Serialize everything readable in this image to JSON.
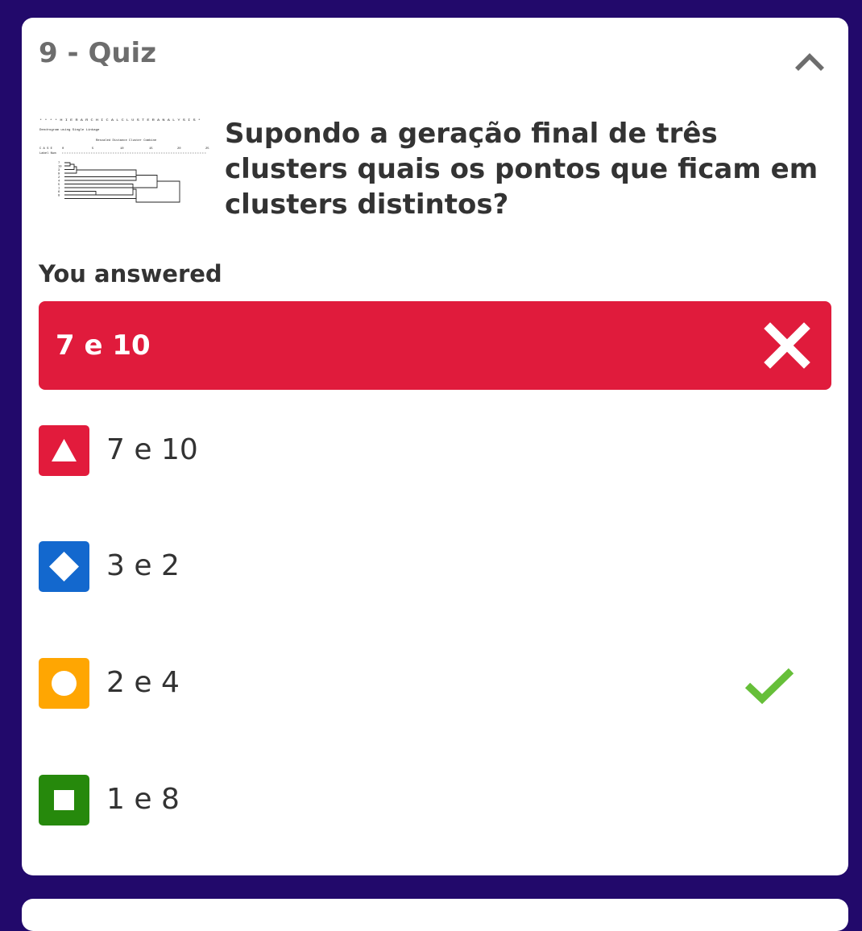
{
  "quiz": {
    "title": "9 - Quiz",
    "question": "Supondo a geração final de três clusters quais os pontos que ficam em clusters distintos?"
  },
  "image": {
    "header": "* * * * H I E R A R C H I C A L   C L U S T E R   A N A L Y S I S *",
    "subheader": "Dendrogram using Single Linkage",
    "caption": "Rescaled Distance Cluster Combine",
    "case_label": "C A S E",
    "label_num": "Label  Num",
    "ticks": [
      "0",
      "5",
      "10",
      "15",
      "20",
      "25"
    ],
    "leaves": [
      "7",
      "10",
      "3",
      "9",
      "2",
      "4",
      "5",
      "1",
      "6",
      "8"
    ]
  },
  "you_answered": {
    "label": "You answered",
    "answer": "7 e 10",
    "status_icon": "x-icon",
    "color": "#e01b3c"
  },
  "options": [
    {
      "label": "7 e 10",
      "shape": "triangle",
      "color": "#e21b3c",
      "correct": false
    },
    {
      "label": "3 e 2",
      "shape": "diamond",
      "color": "#1368ce",
      "correct": false
    },
    {
      "label": "2 e 4",
      "shape": "circle",
      "color": "#ffa602",
      "correct": true
    },
    {
      "label": "1 e 8",
      "shape": "square",
      "color": "#26890c",
      "correct": false
    }
  ],
  "colors": {
    "background": "#22096b",
    "card": "#ffffff",
    "correct_check": "#66bf39"
  }
}
